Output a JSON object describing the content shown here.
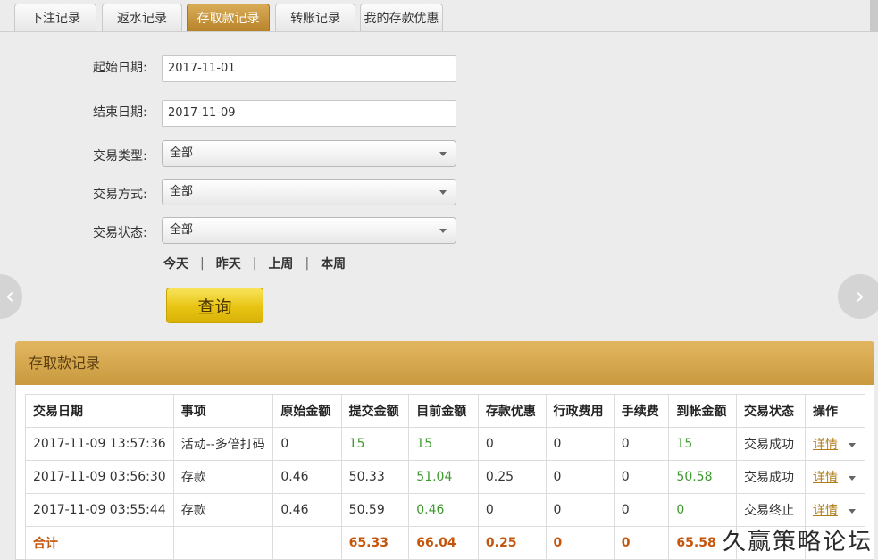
{
  "tabs": [
    {
      "label": "下注记录",
      "active": false
    },
    {
      "label": "返水记录",
      "active": false
    },
    {
      "label": "存取款记录",
      "active": true
    },
    {
      "label": "转账记录",
      "active": false
    },
    {
      "label": "我的存款优惠",
      "active": false
    }
  ],
  "form": {
    "start_label": "起始日期:",
    "start_value": "2017-11-01",
    "end_label": "结束日期:",
    "end_value": "2017-11-09",
    "type_label": "交易类型:",
    "type_value": "全部",
    "method_label": "交易方式:",
    "method_value": "全部",
    "status_label": "交易状态:",
    "status_value": "全部"
  },
  "quick_dates": [
    "今天",
    "昨天",
    "上周",
    "本周"
  ],
  "quick_separator": "|",
  "query_button": "查询",
  "nav": {
    "prev": "‹",
    "next": "›"
  },
  "panel_title": "存取款记录",
  "table": {
    "headers": [
      "交易日期",
      "事项",
      "原始金额",
      "提交金额",
      "目前金额",
      "存款优惠",
      "行政费用",
      "手续费",
      "到帐金额",
      "交易状态",
      "操作"
    ],
    "rows": [
      [
        "2017-11-09 13:57:36",
        "活动--多倍打码",
        "0",
        "15",
        "15",
        "0",
        "0",
        "0",
        "15",
        "交易成功",
        "详情"
      ],
      [
        "2017-11-09 03:56:30",
        "存款",
        "0.46",
        "50.33",
        "51.04",
        "0.25",
        "0",
        "0",
        "50.58",
        "交易成功",
        "详情"
      ],
      [
        "2017-11-09 03:55:44",
        "存款",
        "0.46",
        "50.59",
        "0.46",
        "0",
        "0",
        "0",
        "0",
        "交易终止",
        "详情"
      ]
    ],
    "total": {
      "label": "合计",
      "submitted": "65.33",
      "current": "66.04",
      "bonus": "0.25",
      "admin_fee": "0",
      "fee": "0",
      "received": "65.58"
    }
  },
  "watermark": "久赢策略论坛",
  "colors": {
    "active_tab": "#c08c33",
    "panel_header": "#d4a84f",
    "query_button": "#e8c413",
    "green_amount": "#3e9a2e",
    "total_orange": "#c4550b"
  }
}
